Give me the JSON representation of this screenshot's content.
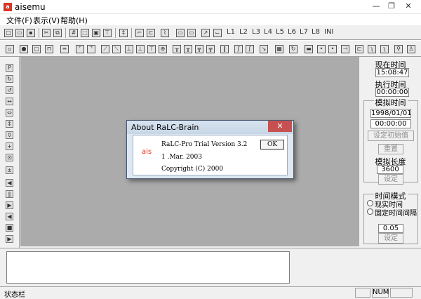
{
  "window": {
    "title": "aisemu",
    "minimize": "—",
    "restore": "❐",
    "close": "✕"
  },
  "menubar": [
    {
      "label": "文件(F)"
    },
    {
      "label": "表示(V)"
    },
    {
      "label": "帮助(H)"
    }
  ],
  "toolbar1": {
    "labels": [
      "L1",
      "L2",
      "L3",
      "L4",
      "L5",
      "L6",
      "L7",
      "L8",
      "INI"
    ]
  },
  "right_panel": {
    "current_time_label": "现在时间",
    "current_time_value": "15:08:47",
    "exec_time_label": "执行时间",
    "exec_time_value": "00:00:00",
    "sim_time_label": "模拟时间",
    "sim_date_value": "1998/01/01",
    "sim_clock_value": "00:00:00",
    "set_init_button": "设定初始值",
    "reset_button": "重置",
    "sim_length_label": "模拟长度",
    "sim_length_value": "3600",
    "set_length_button": "设定",
    "time_mode_label": "时间模式",
    "radio_real": "现实时间",
    "radio_fixed": "固定时间间隔",
    "interval_value": "0.05",
    "set_interval_button": "设定"
  },
  "dialog": {
    "title": "About RaLC-Brain",
    "close": "✕",
    "logo_text": "ais",
    "version": "RaLC-Pro Trial Version 3.2",
    "date": "1 .Mar. 2003",
    "copyright": "Copyright (C) 2000",
    "ok_button": "OK"
  },
  "statusbar": {
    "text": "状态栏",
    "num": "NUM"
  }
}
